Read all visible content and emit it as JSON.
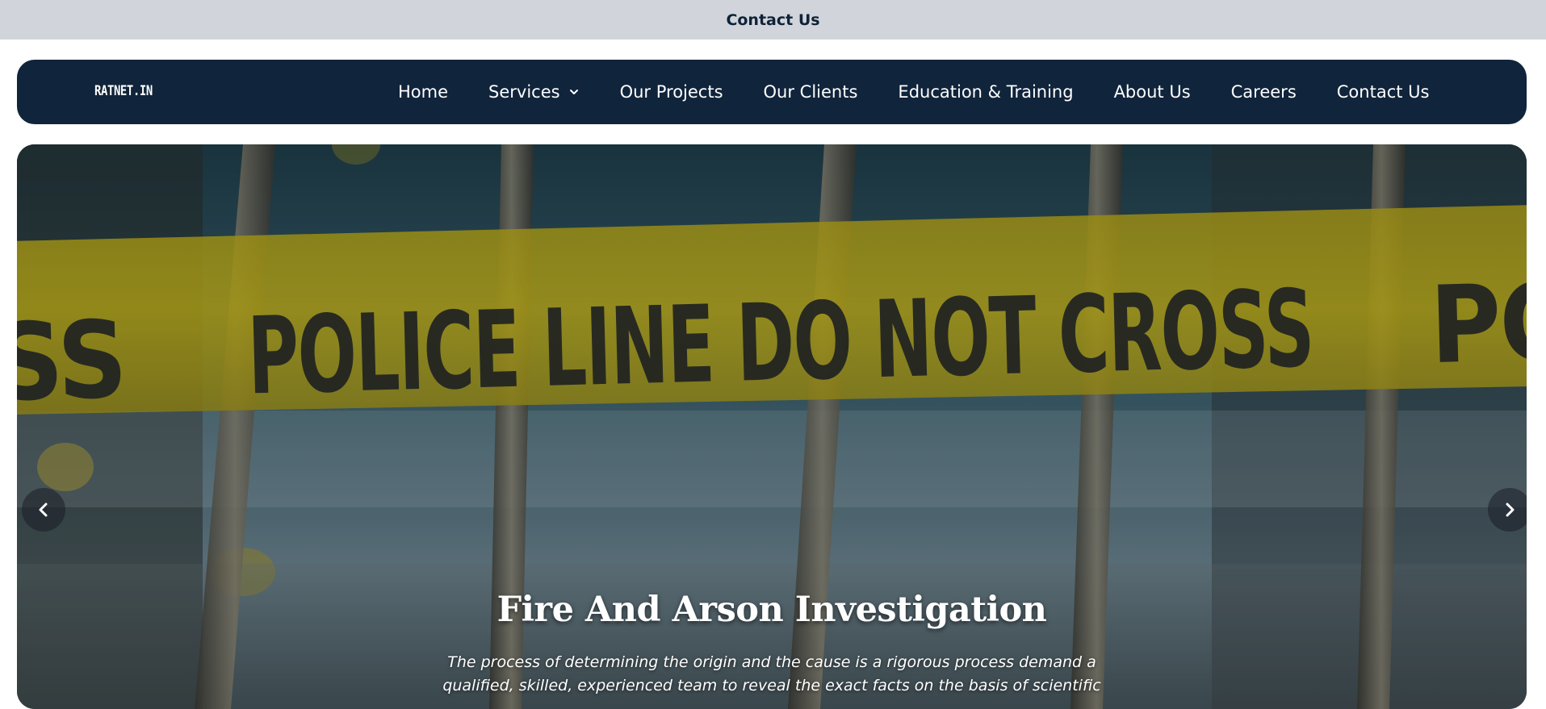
{
  "topbar": {
    "contact_label": "Contact Us"
  },
  "navbar": {
    "logo": "RATNET.IN",
    "items": [
      {
        "label": "Home"
      },
      {
        "label": "Services",
        "has_dropdown": true
      },
      {
        "label": "Our Projects"
      },
      {
        "label": "Our Clients"
      },
      {
        "label": "Education & Training"
      },
      {
        "label": "About Us"
      },
      {
        "label": "Careers"
      },
      {
        "label": "Contact Us"
      }
    ]
  },
  "hero": {
    "image_tape_text": "POLICE LINE DO NOT CROSS",
    "title": "Fire And Arson Investigation",
    "description": "The process of determining the origin and the cause is a rigorous process demand a qualified, skilled, experienced team to reveal the exact facts on the basis of scientific",
    "prev_icon": "chevron-left-icon",
    "next_icon": "chevron-right-icon"
  },
  "colors": {
    "navbar_bg": "#10243b",
    "topbar_bg": "#d1d5db",
    "tape_yellow": "#c9b81a"
  }
}
